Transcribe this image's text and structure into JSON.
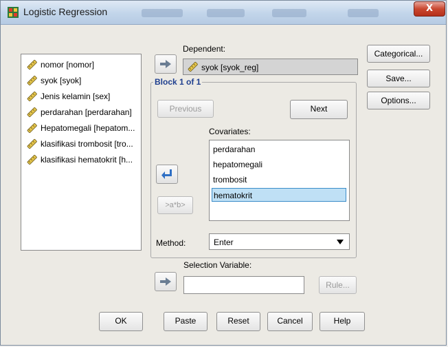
{
  "window": {
    "title": "Logistic Regression",
    "close_glyph": "X"
  },
  "variables": [
    {
      "label": "nomor [nomor]",
      "icon": "ruler-pencil-icon"
    },
    {
      "label": "syok [syok]",
      "icon": "ruler-pencil-icon"
    },
    {
      "label": "Jenis kelamin [sex]",
      "icon": "ruler-pencil-icon"
    },
    {
      "label": "perdarahan  [perdarahan]",
      "icon": "ruler-pencil-icon"
    },
    {
      "label": "Hepatomegali [hepatom...",
      "icon": "ruler-pencil-icon"
    },
    {
      "label": "klasifikasi trombosit [tro...",
      "icon": "ruler-pencil-icon"
    },
    {
      "label": "klasifikasi hematokrit [h...",
      "icon": "ruler-pencil-icon"
    }
  ],
  "dependent": {
    "label": "Dependent:",
    "value": "syok [syok_reg]"
  },
  "block": {
    "title": "Block 1 of 1",
    "previous_label": "Previous",
    "next_label": "Next",
    "covariates_label": "Covariates:",
    "covariates": [
      "perdarahan",
      "hepatomegali",
      "trombosit",
      "hematokrit"
    ],
    "selected_covariate": "hematokrit",
    "interaction_label": ">a*b>"
  },
  "method": {
    "label": "Method:",
    "value": "Enter"
  },
  "selection": {
    "label": "Selection Variable:",
    "value": "",
    "rule_label": "Rule..."
  },
  "side_buttons": {
    "categorical": "Categorical...",
    "save": "Save...",
    "options": "Options..."
  },
  "footer": {
    "ok": "OK",
    "paste": "Paste",
    "reset": "Reset",
    "cancel": "Cancel",
    "help": "Help"
  },
  "colors": {
    "title_accent": "#1f3f8f",
    "selection_highlight": "#bfe0f5",
    "arrow_blue": "#2e6fc4"
  }
}
